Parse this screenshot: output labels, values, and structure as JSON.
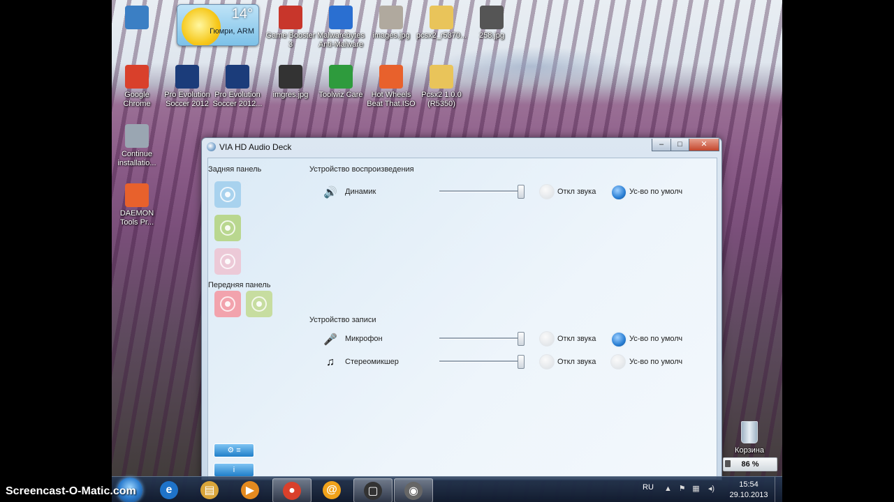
{
  "desktop": {
    "icons": [
      {
        "label": "",
        "icon": "computer-icon",
        "color": "#3b7fc4"
      },
      {
        "label": "Game Booster 3",
        "icon": "game-booster-icon",
        "color": "#c8362b"
      },
      {
        "label": "Malwarebytes Anti-Malware",
        "icon": "malwarebytes-icon",
        "color": "#2a6fd1"
      },
      {
        "label": "images.jpg",
        "icon": "image-file-icon",
        "color": "#b0a99e"
      },
      {
        "label": "pcsx2_r5370...",
        "icon": "folder-icon",
        "color": "#e9c45a"
      },
      {
        "label": "258.jpg",
        "icon": "image-file-icon",
        "color": "#555555"
      },
      {
        "label": "Google Chrome",
        "icon": "chrome-icon",
        "color": "#d9402b"
      },
      {
        "label": "Pro Evolution Soccer 2012",
        "icon": "pes-icon",
        "color": "#1b3c7a"
      },
      {
        "label": "Pro Evolution Soccer 2012...",
        "icon": "pes-icon",
        "color": "#1b3c7a"
      },
      {
        "label": "imgres.jpg",
        "icon": "image-file-icon",
        "color": "#333333"
      },
      {
        "label": "Toolwiz Care",
        "icon": "toolwiz-icon",
        "color": "#2e9b3d"
      },
      {
        "label": "Hot Wheels Beat That.ISO",
        "icon": "daemon-disc-icon",
        "color": "#e8612c"
      },
      {
        "label": "Pcsx2 1.0.0 (R5350)",
        "icon": "folder-icon",
        "color": "#e9c45a"
      },
      {
        "label": "Continue installatio...",
        "icon": "installer-icon",
        "color": "#9aa6b2"
      },
      {
        "label": "DAEMON Tools Pr...",
        "icon": "daemon-tools-icon",
        "color": "#e8612c"
      }
    ],
    "weather": {
      "temp": "14°",
      "city": "Гюмри, ARM"
    },
    "recycle_bin": "Корзина",
    "battery": "86 %"
  },
  "window": {
    "title": "VIA HD Audio Deck",
    "rear_panel": "Задняя панель",
    "front_panel": "Передняя панель",
    "rear_jacks": [
      "#a8d2ee",
      "#b9d78f",
      "#ecc9d7"
    ],
    "front_jacks": [
      "#f2a3ad",
      "#c7dda0"
    ],
    "playback_header": "Устройство воспроизведения",
    "record_header": "Устройство записи",
    "mute_label": "Откл звука",
    "default_label": "Ус-во по умолч",
    "playback": [
      {
        "name": "Динамик",
        "icon": "speaker-icon",
        "volume": 0.95,
        "muted": false,
        "is_default": true
      }
    ],
    "recording": [
      {
        "name": "Микрофон",
        "icon": "microphone-icon",
        "volume": 0.95,
        "muted": false,
        "is_default": true
      },
      {
        "name": "Стереомикшер",
        "icon": "stereo-mixer-icon",
        "volume": 0.95,
        "muted": false,
        "is_default": false
      }
    ]
  },
  "taskbar": {
    "lang": "RU",
    "time": "15:54",
    "date": "29.10.2013",
    "buttons": [
      {
        "icon": "ie-icon",
        "glyph": "e",
        "color": "#1f73c9",
        "open": false
      },
      {
        "icon": "explorer-folder-icon",
        "glyph": "▤",
        "color": "#d9a53a",
        "open": false
      },
      {
        "icon": "media-player-icon",
        "glyph": "▶",
        "color": "#e48a1f",
        "open": false
      },
      {
        "icon": "chrome-icon",
        "glyph": "●",
        "color": "#d9402b",
        "open": true
      },
      {
        "icon": "mail-agent-icon",
        "glyph": "@",
        "color": "#f0a21a",
        "open": false
      },
      {
        "icon": "screen-recorder-icon",
        "glyph": "▢",
        "color": "#333333",
        "open": true
      },
      {
        "icon": "audio-deck-icon",
        "glyph": "◉",
        "color": "#666666",
        "open": true
      }
    ]
  },
  "watermark": "Screencast-O-Matic.com"
}
